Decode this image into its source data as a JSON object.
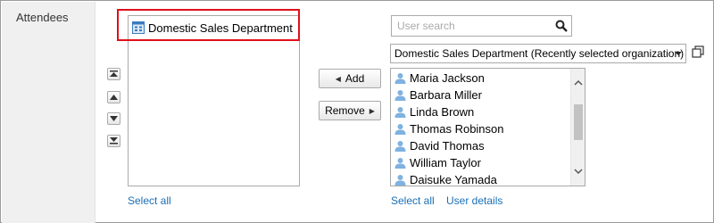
{
  "row_label": "Attendees",
  "selected": {
    "items": [
      {
        "label": "Domestic Sales Department",
        "icon": "organization-icon"
      }
    ],
    "select_all": "Select all"
  },
  "order_buttons": [
    "move-to-top-icon",
    "move-up-icon",
    "move-down-icon",
    "move-to-bottom-icon"
  ],
  "actions": {
    "add": "Add",
    "remove": "Remove"
  },
  "search": {
    "placeholder": "User search",
    "value": ""
  },
  "org_select": {
    "selected": "Domestic Sales Department (Recently selected organization)"
  },
  "users": [
    "Maria Jackson",
    "Barbara Miller",
    "Linda Brown",
    "Thomas Robinson",
    "David Thomas",
    "William Taylor",
    "Daisuke Yamada"
  ],
  "links": {
    "select_all": "Select all",
    "user_details": "User details"
  },
  "colors": {
    "link": "#1a6fb5",
    "highlight": "#e0101a",
    "label_bg": "#f0f0f0"
  }
}
